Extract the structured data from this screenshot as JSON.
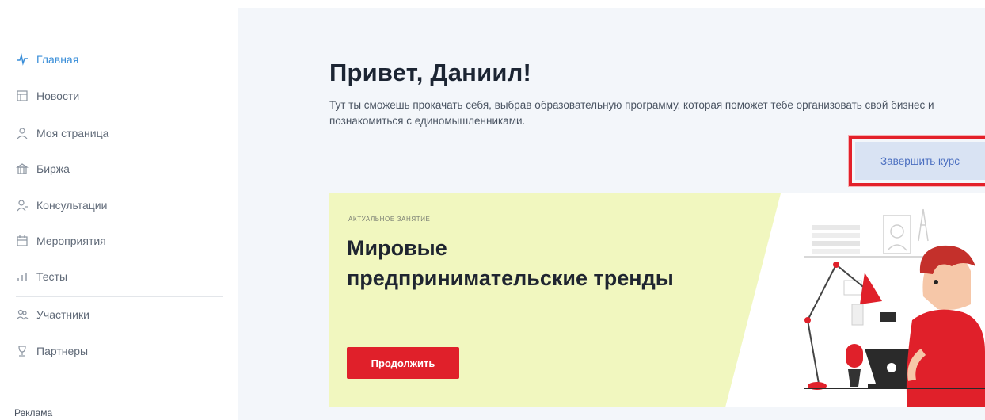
{
  "sidebar": {
    "items": [
      {
        "label": "Главная",
        "icon": "pulse-icon",
        "active": true
      },
      {
        "label": "Новости",
        "icon": "news-icon"
      },
      {
        "label": "Моя страница",
        "icon": "user-icon"
      },
      {
        "label": "Биржа",
        "icon": "exchange-icon"
      },
      {
        "label": "Консультации",
        "icon": "consult-icon"
      },
      {
        "label": "Мероприятия",
        "icon": "calendar-icon"
      },
      {
        "label": "Тесты",
        "icon": "bar-chart-icon"
      },
      {
        "label": "Участники",
        "icon": "users-icon"
      },
      {
        "label": "Партнеры",
        "icon": "partner-icon"
      }
    ],
    "ad_label": "Реклама"
  },
  "main": {
    "greeting": "Привет, Даниил!",
    "intro": "Тут ты сможешь прокачать себя, выбрав образовательную программу, которая поможет тебе организовать свой бизнес и познакомиться с единомышленниками.",
    "finish_button": "Завершить курс",
    "card": {
      "kicker": "АКТУАЛЬНОЕ ЗАНЯТИЕ",
      "title": "Мировые предпринимательские тренды",
      "continue_button": "Продолжить"
    }
  },
  "colors": {
    "accent": "#3b8fd9",
    "primary_red": "#e0202a",
    "card_bg": "#f1f7bf",
    "finish_btn_bg": "#d9e3f3"
  }
}
